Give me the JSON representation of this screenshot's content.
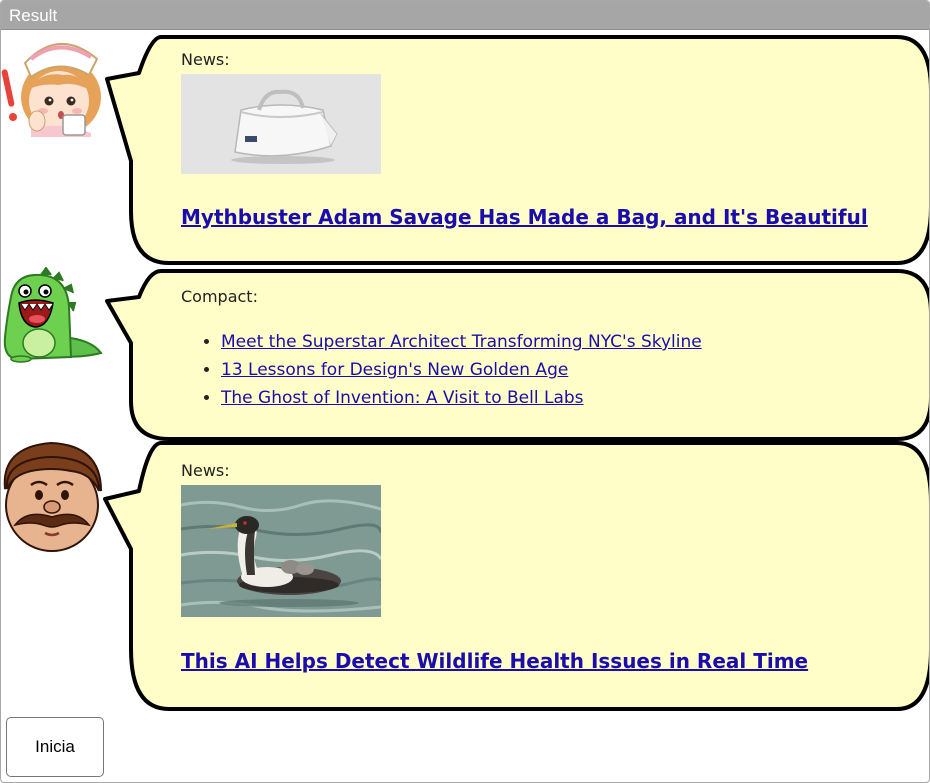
{
  "window": {
    "title": "Result"
  },
  "messages": [
    {
      "avatar": "nurse-avatar",
      "type": "News:",
      "image": "white-bag-photo",
      "headline": "Mythbuster Adam Savage Has Made a Bag, and It's Beautiful"
    },
    {
      "avatar": "dinosaur-avatar",
      "type": "Compact:",
      "items": [
        "Meet the Superstar Architect Transforming NYC's Skyline",
        "13 Lessons for Design's New Golden Age",
        "The Ghost of Invention: A Visit to Bell Labs"
      ]
    },
    {
      "avatar": "mustache-man-avatar",
      "type": "News:",
      "image": "grebe-bird-photo",
      "headline": "This AI Helps Detect Wildlife Health Issues in Real Time"
    }
  ],
  "controls": {
    "start_label": "Inicia"
  },
  "colors": {
    "bubble_fill": "#fffdc8",
    "link": "#1a0dab",
    "bar": "#a6a6a6"
  }
}
